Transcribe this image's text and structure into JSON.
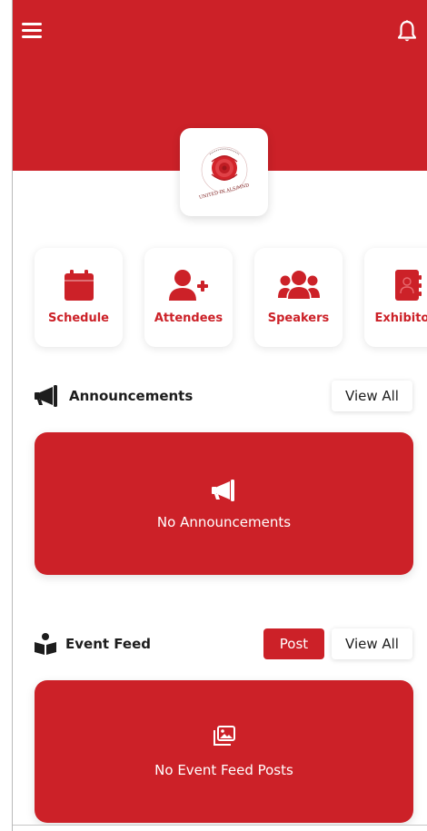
{
  "app": {
    "logo_alt": "UNITED IN ALS/MND"
  },
  "colors": {
    "brand": "#cc2128",
    "background": "#ffffff",
    "text": "#1d1d1d"
  },
  "header": {
    "menu_icon": "hamburger-menu-icon",
    "bell_icon": "bell-icon"
  },
  "quick_links": [
    {
      "label": "Schedule",
      "icon": "calendar-icon"
    },
    {
      "label": "Attendees",
      "icon": "add-user-icon"
    },
    {
      "label": "Speakers",
      "icon": "users-group-icon"
    },
    {
      "label": "Exhibitors",
      "icon": "address-book-icon"
    }
  ],
  "announcements": {
    "title": "Announcements",
    "icon": "megaphone-icon",
    "view_all_label": "View All",
    "empty_text": "No Announcements"
  },
  "event_feed": {
    "title": "Event Feed",
    "icon": "reader-icon",
    "post_label": "Post",
    "view_all_label": "View All",
    "empty_text": "No Event Feed Posts"
  }
}
